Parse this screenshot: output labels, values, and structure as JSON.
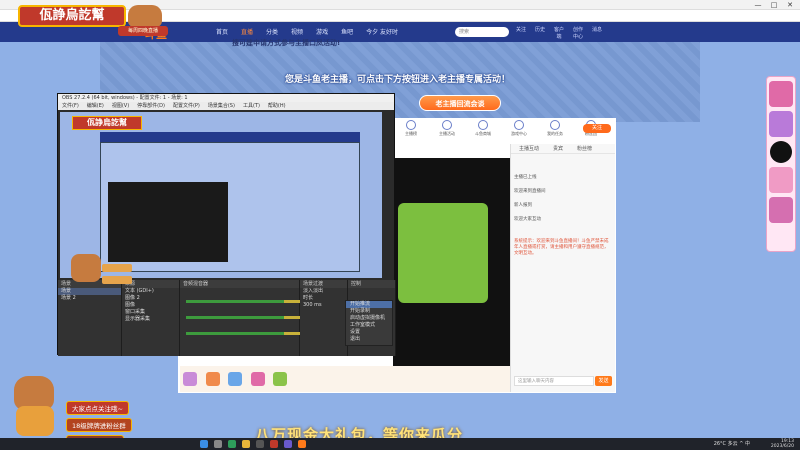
{
  "overlay": {
    "title": "佤諍烏訖幫",
    "subtitle": "每周四晚直播"
  },
  "site": {
    "nav": [
      "首页",
      "直播",
      "分类",
      "视频",
      "游戏",
      "鱼吧",
      "今夕 友好时"
    ],
    "nav_active_index": 1,
    "search_placeholder": "搜索",
    "header_icons": [
      "关注",
      "历史",
      "客户端",
      "创作中心",
      "消息"
    ],
    "banner_small": "搜可建申请方式参与主播口凤活动!",
    "banner_main": "您是斗鱼老主播，可点击下方按钮进入老主播专属活动！",
    "banner_button": "老主播回流会谈",
    "bottom_banner": "八万现金大礼包，等你来瓜分"
  },
  "obs": {
    "title": "OBS 27.2.4 (64 bit, windows) - 配置文件: 1 - 场景: 1",
    "menu": [
      "文件(F)",
      "编辑(E)",
      "视图(V)",
      "停靠部件(D)",
      "配置文件(P)",
      "场景集合(S)",
      "工具(T)",
      "帮助(H)"
    ],
    "preview_title": "佤諍烏訖幫",
    "docks": {
      "scenes_head": "场景",
      "scenes": [
        "场景",
        "场景 2"
      ],
      "sources_head": "来源",
      "sources": [
        "文本 (GDI+)",
        "图像 2",
        "图像",
        "窗口采集",
        "显示器采集"
      ],
      "mixer_head": "音频混音器",
      "transitions_head": "场景过渡",
      "transition_value": "淡入淡出",
      "duration_label": "时长",
      "duration_value": "300 ms",
      "controls_head": "控制"
    },
    "context_menu": [
      "开始推流",
      "开始录制",
      "启动虚拟摄像机",
      "工作室模式",
      "设置",
      "退出"
    ],
    "context_highlight_index": 0
  },
  "page": {
    "categories": [
      "主播榜",
      "主播活动",
      "斗鱼商城",
      "游戏中心",
      "我的任务",
      "粉丝团",
      "鱼吧",
      "主播任务",
      "互动"
    ],
    "follow_label": "关注",
    "chat_tabs": [
      "主播互动",
      "贵宾",
      "粉丝榜"
    ],
    "chat_rows": [
      "主播已上线",
      "欢迎来到直播间",
      "新人报到",
      "欢迎大家互动"
    ],
    "chat_notice": "系统提示：欢迎来到斗鱼直播间！斗鱼严禁未成年人直播或打赏，请主播和用户遵守直播规范，文明互动。",
    "chat_input_placeholder": "这里输入聊天内容",
    "chat_send": "发送"
  },
  "bottom_left": {
    "tag1": "大家点点关注哦~",
    "tag2": "18级牌牌进粉丝群",
    "tag3": "有奖是个鸽屋啦"
  },
  "taskbar": {
    "tray": "26°C 多云 ^ 中",
    "time": "19:13",
    "date": "2023/6/20"
  },
  "colors": {
    "site_header": "#243a8c",
    "accent": "#ff6a1c",
    "overlay_red": "#c0392b",
    "overlay_gold": "#f7b500"
  }
}
